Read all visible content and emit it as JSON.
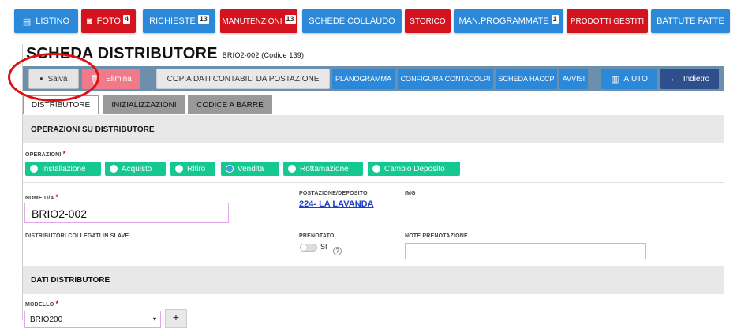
{
  "topnav": [
    {
      "label": "LISTINO",
      "icon": "list-icon",
      "color": "blue"
    },
    {
      "label": "FOTO",
      "icon": "camera-icon",
      "color": "red",
      "badge": "4"
    },
    {
      "label": "RICHIESTE",
      "color": "blue",
      "badge": "13"
    },
    {
      "label": "MANUTENZIONI",
      "color": "red",
      "badge": "13"
    },
    {
      "label": "SCHEDE COLLAUDO",
      "color": "blue"
    },
    {
      "label": "STORICO",
      "color": "red"
    },
    {
      "label": "MAN.PROGRAMMATE",
      "color": "blue",
      "badge": "1"
    },
    {
      "label": "PRODOTTI GESTITI",
      "color": "red"
    },
    {
      "label": "BATTUTE FATTE",
      "color": "blue"
    }
  ],
  "page": {
    "title": "SCHEDA DISTRIBUTORE",
    "subtitle": "BRIO2-002 (Codice 139)"
  },
  "toolbar": {
    "save": "Salva",
    "delete": "Elimina",
    "copy": "COPIA DATI CONTABILI DA POSTAZIONE",
    "planogram": "PLANOGRAMMA",
    "counters": "CONFIGURA CONTACOLPI",
    "haccp": "SCHEDA HACCP",
    "notices": "AVVISI",
    "help": "AIUTO",
    "back": "Indietro"
  },
  "tabs": [
    "DISTRIBUTORE",
    "INIZIALIZZAZIONI",
    "CODICE A BARRE"
  ],
  "operations": {
    "section": "OPERAZIONI SU DISTRIBUTORE",
    "label": "OPERAZIONI",
    "options": [
      "Installazione",
      "Acquisto",
      "Ritiro",
      "Vendita",
      "Rottamazione",
      "Cambio Deposito"
    ],
    "selected": "Vendita"
  },
  "fields": {
    "name_label": "NOME D/A",
    "name_value": "BRIO2-002",
    "location_label": "POSTAZIONE/DEPOSITO",
    "location_value": "224- LA LAVANDA",
    "img_label": "IMG",
    "slave_label": "DISTRIBUTORI COLLEGATI IN SLAVE",
    "reserved_label": "PRENOTATO",
    "reserved_toggle": "SI",
    "notes_label": "NOTE PRENOTAZIONE"
  },
  "dati": {
    "section": "DATI DISTRIBUTORE",
    "model_label": "MODELLO",
    "model_value": "BRIO200",
    "add": "+"
  },
  "colors": {
    "blue": "#2c88d9",
    "red": "#d3131d",
    "green": "#14c98f",
    "toolbar": "#6c8fae"
  }
}
